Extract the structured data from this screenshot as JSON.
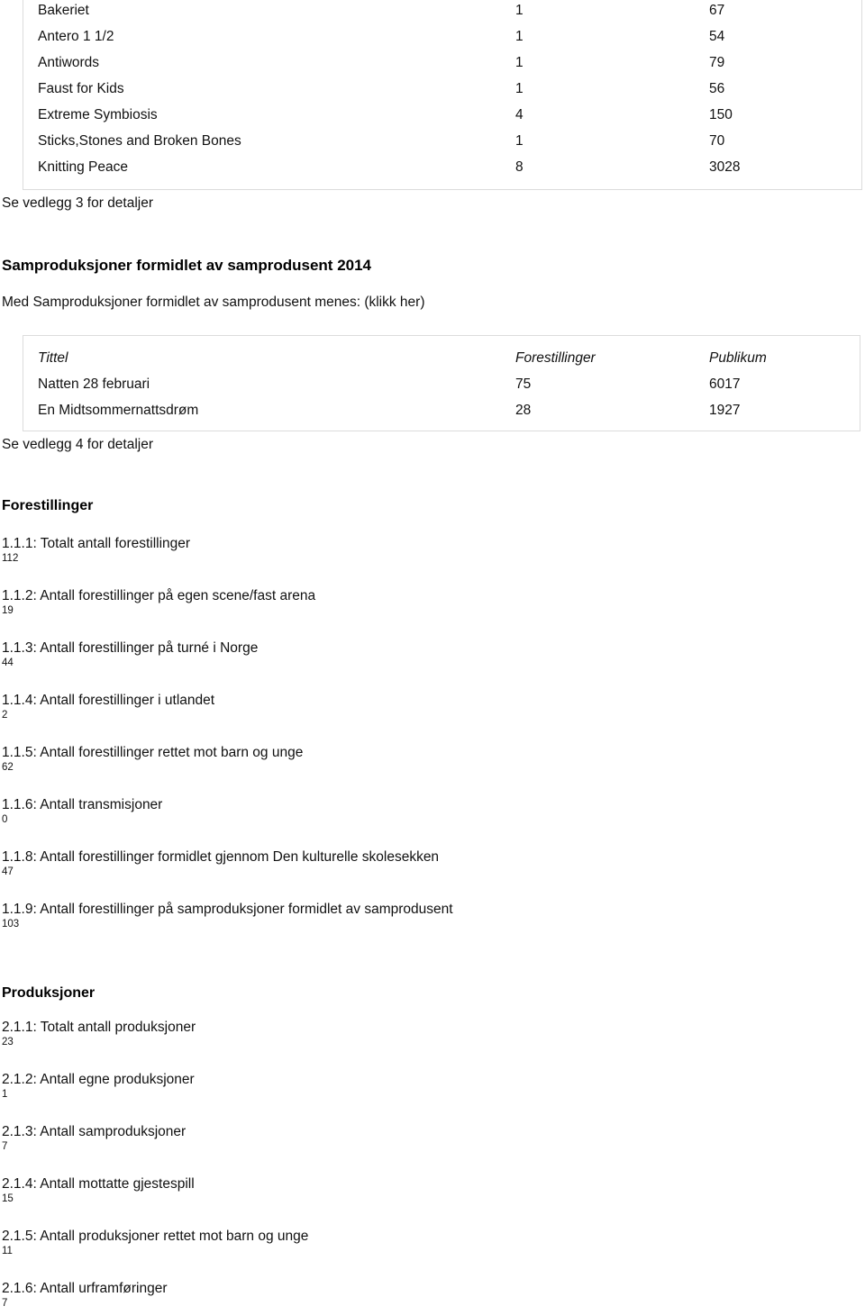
{
  "tables": {
    "productions_list": {
      "columns": [
        "Tittel",
        "Forestillinger",
        "Publikum"
      ],
      "show_header": false,
      "rows": [
        {
          "title": "Bakeriet",
          "performances": "1",
          "audience": "67"
        },
        {
          "title": "Antero 1 1/2",
          "performances": "1",
          "audience": "54"
        },
        {
          "title": "Antiwords",
          "performances": "1",
          "audience": "79"
        },
        {
          "title": "Faust for Kids",
          "performances": "1",
          "audience": "56"
        },
        {
          "title": "Extreme Symbiosis",
          "performances": "4",
          "audience": "150"
        },
        {
          "title": "Sticks,Stones and Broken Bones",
          "performances": "1",
          "audience": "70"
        },
        {
          "title": "Knitting Peace",
          "performances": "8",
          "audience": "3028"
        }
      ]
    },
    "co_productions_2014": {
      "columns": [
        "Tittel",
        "Forestillinger",
        "Publikum"
      ],
      "show_header": true,
      "rows": [
        {
          "title": "Natten 28 februari",
          "performances": "75",
          "audience": "6017"
        },
        {
          "title": "En Midtsommernattsdrøm",
          "performances": "28",
          "audience": "1927"
        }
      ]
    }
  },
  "notes": {
    "appendix_3": "Se vedlegg 3 for detaljer",
    "appendix_4": "Se vedlegg 4 for detaljer"
  },
  "section_coprod": {
    "heading": "Samproduksjoner formidlet av samprodusent 2014",
    "intro": "Med Samproduksjoner formidlet av samprodusent menes: (klikk her)"
  },
  "section_performances": {
    "heading": "Forestillinger",
    "metrics": [
      {
        "label": "1.1.1: Totalt antall forestillinger",
        "value": "112"
      },
      {
        "label": "1.1.2: Antall forestillinger på egen scene/fast arena",
        "value": "19"
      },
      {
        "label": "1.1.3: Antall forestillinger på turné i Norge",
        "value": "44"
      },
      {
        "label": "1.1.4: Antall forestillinger i utlandet",
        "value": "2"
      },
      {
        "label": "1.1.5: Antall forestillinger rettet mot barn og unge",
        "value": "62"
      },
      {
        "label": "1.1.6: Antall transmisjoner",
        "value": "0"
      },
      {
        "label": "1.1.8: Antall forestillinger formidlet gjennom Den kulturelle skolesekken",
        "value": "47"
      },
      {
        "label": "1.1.9: Antall forestillinger på samproduksjoner formidlet av samprodusent",
        "value": "103"
      }
    ]
  },
  "section_productions": {
    "heading": "Produksjoner",
    "metrics": [
      {
        "label": "2.1.1: Totalt antall produksjoner",
        "value": "23"
      },
      {
        "label": "2.1.2: Antall egne produksjoner",
        "value": "1"
      },
      {
        "label": "2.1.3: Antall samproduksjoner",
        "value": "7"
      },
      {
        "label": "2.1.4: Antall mottatte gjestespill",
        "value": "15"
      },
      {
        "label": "2.1.5: Antall produksjoner rettet mot barn og unge",
        "value": "11"
      },
      {
        "label": "2.1.6: Antall urframføringer",
        "value": "7"
      }
    ]
  },
  "colors": {
    "text": "#111111",
    "table_border": "#dcdcdc",
    "background": "#ffffff"
  }
}
